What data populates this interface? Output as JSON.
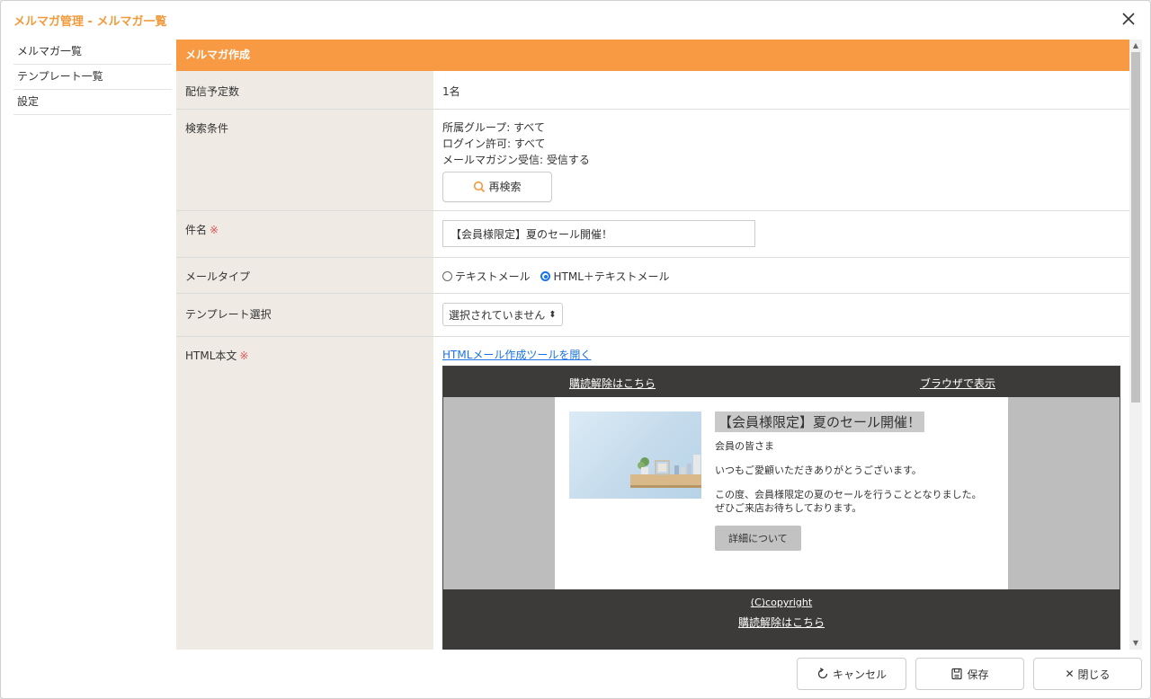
{
  "window": {
    "title": "メルマガ管理 - メルマガ一覧"
  },
  "sidebar": {
    "items": [
      {
        "label": "メルマガ一覧"
      },
      {
        "label": "テンプレート一覧"
      },
      {
        "label": "設定"
      }
    ]
  },
  "section": {
    "header": "メルマガ作成"
  },
  "form": {
    "recipients": {
      "label": "配信予定数",
      "value": "1名"
    },
    "conditions": {
      "label": "検索条件",
      "lines": [
        "所属グループ: すべて",
        "ログイン許可: すべて",
        "メールマガジン受信: 受信する"
      ],
      "research_button": "再検索"
    },
    "subject": {
      "label": "件名",
      "required_mark": "※",
      "value": "【会員様限定】夏のセール開催！"
    },
    "mail_type": {
      "label": "メールタイプ",
      "options": [
        {
          "label": "テキストメール",
          "selected": false
        },
        {
          "label": "HTML＋テキストメール",
          "selected": true
        }
      ]
    },
    "template": {
      "label": "テンプレート選択",
      "selected": "選択されていません",
      "arrow": "⬍"
    },
    "html_body": {
      "label": "HTML本文",
      "required_mark": "※",
      "tool_link": "HTMLメール作成ツールを開く"
    }
  },
  "preview": {
    "unsubscribe_top": "購読解除はこちら",
    "view_in_browser": "ブラウザで表示",
    "title": "【会員様限定】夏のセール開催！",
    "greeting": "会員の皆さま",
    "thanks": "いつもご愛顧いただきありがとうございます。",
    "body1": "この度、会員様限定の夏のセールを行うこととなりました。",
    "body2": "ぜひご来店お待ちしております。",
    "details_button": "詳細について",
    "copyright": "(C)copyright",
    "unsubscribe_bottom": "購読解除はこちら"
  },
  "footer": {
    "cancel": "キャンセル",
    "save": "保存",
    "close": "閉じる",
    "close_glyph": "✕"
  },
  "colors": {
    "accent": "#f79a43",
    "title": "#f39a3d",
    "label_bg": "#efeae4",
    "link": "#1a73e8",
    "dark": "#3d3b3a"
  },
  "icons": [
    "close-icon",
    "search-icon",
    "refresh-icon",
    "save-icon"
  ]
}
